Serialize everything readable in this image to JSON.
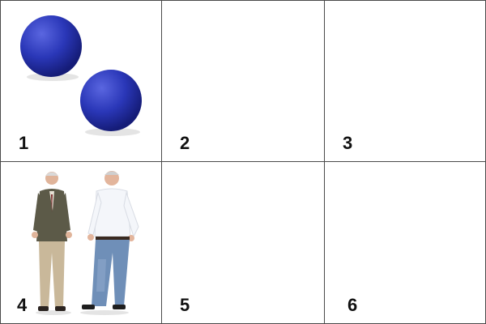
{
  "cells": [
    {
      "number": "1",
      "content": "two-blue-balls"
    },
    {
      "number": "2",
      "content": "empty"
    },
    {
      "number": "3",
      "content": "empty"
    },
    {
      "number": "4",
      "content": "two-older-men"
    },
    {
      "number": "5",
      "content": "empty"
    },
    {
      "number": "6",
      "content": "empty"
    }
  ],
  "colors": {
    "ball_blue": "#2a37b8",
    "ball_highlight": "#5a66e0",
    "border": "#4a4a4a"
  }
}
